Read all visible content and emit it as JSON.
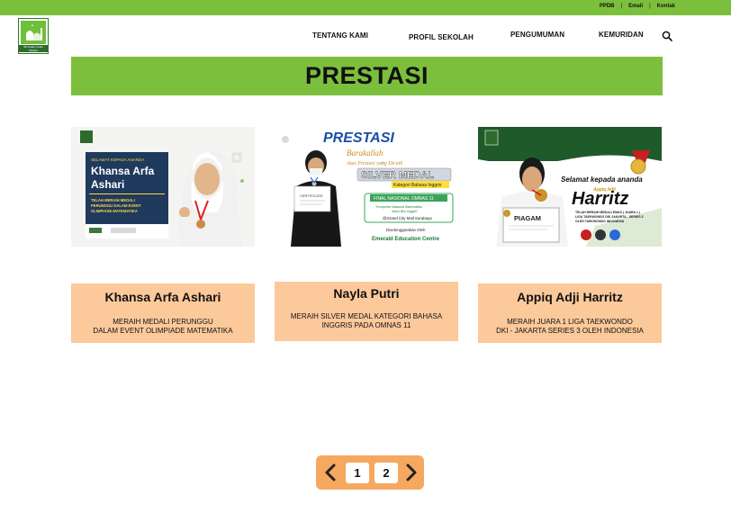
{
  "header": {
    "top_links": [
      "PPDB",
      "Email",
      "Kontak"
    ],
    "logo_text": "SD Kalam Insan Madani",
    "nav": [
      "TENTANG KAMI",
      "PROFIL SEKOLAH",
      "PENGUMUMAN",
      "KEMURIDAN"
    ]
  },
  "page_title": "PRESTASI",
  "cards": [
    {
      "img": {
        "greeting": "SELAMAT KEPADA ANANDA",
        "name": "Khansa Arfa Ashari",
        "desc": "TELAH MERAIH MEDALI PERUNGGU DALAM EVENT OLIMPIADE MATEMATIKA"
      },
      "name": "Khansa Arfa Ashari",
      "desc_lines": [
        "MERAIH MEDALI PERUNGGU",
        "DALAM EVENT OLIMPIADE MATEMATIKA"
      ]
    },
    {
      "img": {
        "title": "PRESTASI",
        "line1": "Barakallah",
        "line2": "Atas Prestasi yang Diraih",
        "medal": "SILVER MEDAL",
        "sub": "Kategori Bahasa Inggris",
        "box1": "FINAL NASIONAL OMNAS 11",
        "box2": "\"Kompetisi Nasional Matematika Sains Bhs Inggris\"",
        "box3": "@Grand City Mall Surabaya",
        "org1": "Diselenggarakan Oleh",
        "org2": "Emerald Education Centre"
      },
      "name": "Nayla Putri",
      "desc_lines": [
        "MERAIH SILVER MEDAL KATEGORI BAHASA",
        "INGGRIS PADA OMNAS 11"
      ]
    },
    {
      "img": {
        "line1": "Selamat kepada ananda",
        "small": "Appiq Adji",
        "name": "Harritz",
        "certificate": "PIAGAM",
        "desc": "TELAH MERAIH MEDALI EMAS ( JUARA 1 ) LIGA TAEKWONDO DKI JAKARTA - SERIES 3 OLEH TAEKWONDO INDONESIA"
      },
      "name": "Appiq Adji Harritz",
      "desc_lines": [
        "MERAIH JUARA 1 LIGA TAEKWONDO",
        "DKI - JAKARTA SERIES 3 OLEH INDONESIA"
      ]
    }
  ],
  "pagination": {
    "pages": [
      "1",
      "2"
    ]
  }
}
